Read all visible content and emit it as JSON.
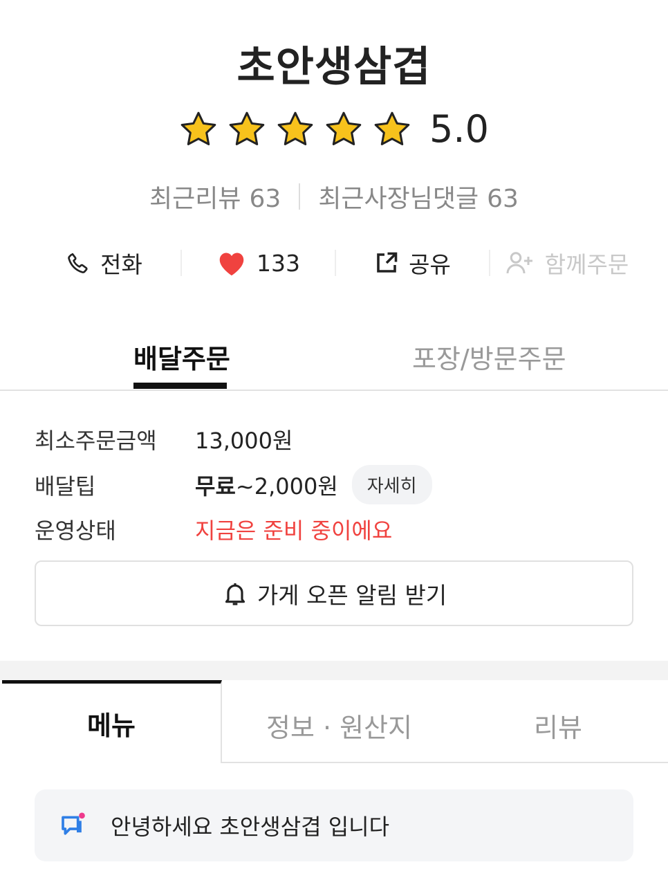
{
  "store": {
    "name": "초안생삼겹",
    "rating": {
      "score": "5.0",
      "stars": 5
    },
    "recent_review_label": "최근리뷰",
    "recent_review_count": "63",
    "owner_reply_label": "최근사장님댓글",
    "owner_reply_count": "63"
  },
  "actions": {
    "call": {
      "label": "전화",
      "icon": "phone-icon"
    },
    "like": {
      "count": "133",
      "icon": "heart-icon"
    },
    "share": {
      "label": "공유",
      "icon": "share-icon"
    },
    "group_order": {
      "label": "함께주문",
      "icon": "add-person-icon"
    }
  },
  "order_tabs": {
    "delivery": "배달주문",
    "pickup": "포장/방문주문"
  },
  "info": {
    "min_order_label": "최소주문금액",
    "min_order_value": "13,000원",
    "delivery_tip_label": "배달팁",
    "delivery_tip_free": "무료",
    "delivery_tip_range": "~2,000원",
    "detail_button": "자세히",
    "status_label": "운영상태",
    "status_value": "지금은 준비 중이에요"
  },
  "notify_button": {
    "label": "가게 오픈 알림 받기",
    "icon": "bell-icon"
  },
  "menu_tabs": {
    "menu": "메뉴",
    "info": "정보 · 원산지",
    "review": "리뷰"
  },
  "notice": {
    "text": "안녕하세요 초안생삼겹 입니다",
    "icon": "chat-notice-icon"
  },
  "colors": {
    "accent_red": "#f0423f",
    "star": "#f7c21c",
    "notice_dot": "#ee3a8c",
    "notice_icon": "#2f7fe6"
  }
}
